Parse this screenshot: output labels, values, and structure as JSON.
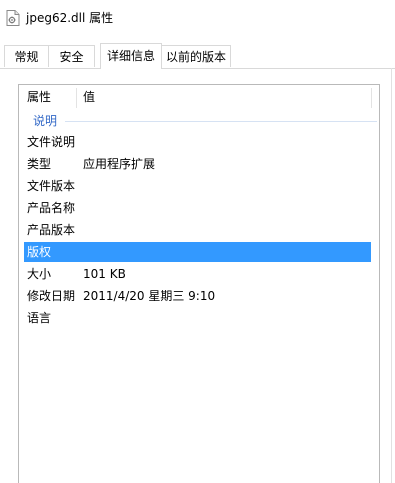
{
  "window": {
    "title": "jpeg62.dll 属性"
  },
  "tabs": [
    {
      "label": "常规",
      "active": false
    },
    {
      "label": "安全",
      "active": false
    },
    {
      "label": "详细信息",
      "active": true
    },
    {
      "label": "以前的版本",
      "active": false
    }
  ],
  "list": {
    "headers": {
      "property": "属性",
      "value": "值"
    },
    "group": "说明",
    "rows": [
      {
        "property": "文件说明",
        "value": ""
      },
      {
        "property": "类型",
        "value": "应用程序扩展"
      },
      {
        "property": "文件版本",
        "value": ""
      },
      {
        "property": "产品名称",
        "value": ""
      },
      {
        "property": "产品版本",
        "value": ""
      },
      {
        "property": "版权",
        "value": "",
        "selected": true
      },
      {
        "property": "大小",
        "value": "101 KB"
      },
      {
        "property": "修改日期",
        "value": "2011/4/20 星期三 9:10"
      },
      {
        "property": "语言",
        "value": ""
      }
    ]
  },
  "colors": {
    "selection": "#3399ff",
    "group_text": "#3369c7"
  }
}
